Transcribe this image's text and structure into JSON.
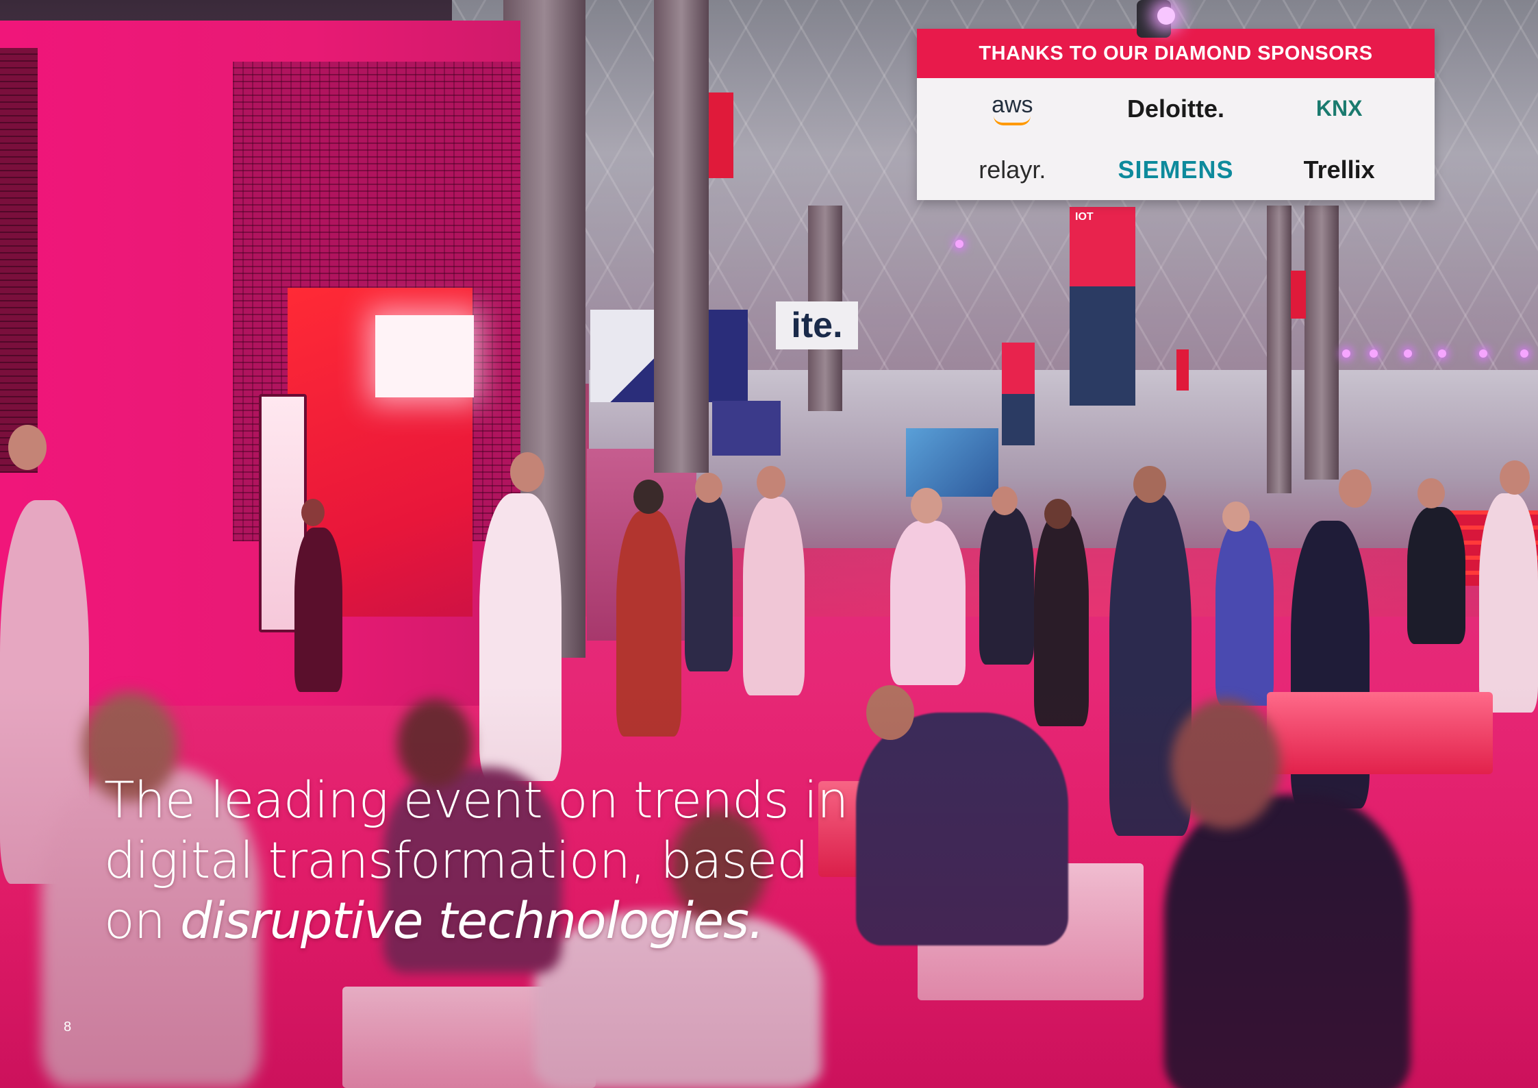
{
  "photo": {
    "sponsor_banner": {
      "heading": "THANKS TO OUR DIAMOND SPONSORS",
      "logos": [
        "aws",
        "Deloitte.",
        "KNX",
        "relayr.",
        "SIEMENS",
        "Trellix"
      ]
    },
    "iot_banner_title": "IOT",
    "ite_sign_text": "ite."
  },
  "headline": {
    "line1": "The leading event on trends in",
    "line2": "digital transformation, based",
    "line3_prefix": "on ",
    "line3_emphasis": "disruptive technologies."
  },
  "page_number": "8",
  "colors": {
    "brand_pink": "#e81a74",
    "banner_red": "#e81a4b",
    "text_white": "#ffffff"
  }
}
